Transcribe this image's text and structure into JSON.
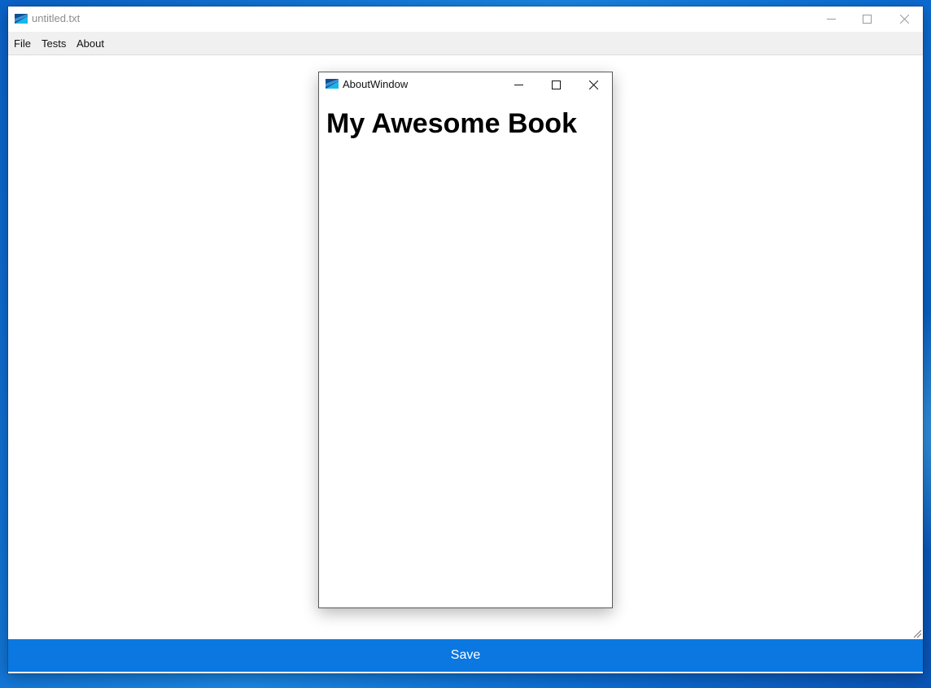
{
  "main_window": {
    "title": "untitled.txt",
    "icon": "app-icon",
    "menu": [
      {
        "label": "File"
      },
      {
        "label": "Tests"
      },
      {
        "label": "About"
      }
    ],
    "editor_text": "",
    "save_label": "Save"
  },
  "about_window": {
    "title": "AboutWindow",
    "icon": "app-icon",
    "heading": "My Awesome Book"
  },
  "colors": {
    "accent": "#0a78e0",
    "desktop": "#1a86e3",
    "menubar": "#f0f0f0"
  }
}
